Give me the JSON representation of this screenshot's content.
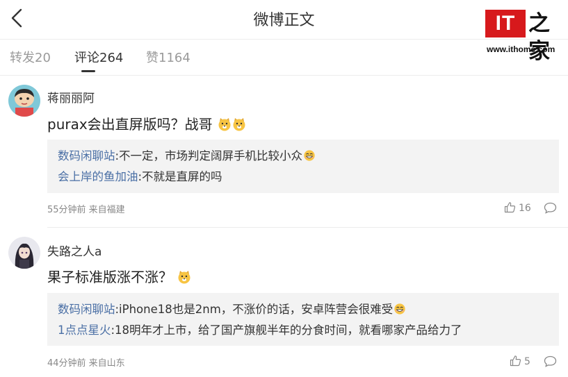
{
  "header": {
    "title": "微博正文"
  },
  "logo": {
    "brand": "IT之家",
    "it_text": "IT",
    "zh_text": "之家",
    "url": "www.ithome.com"
  },
  "tabs": [
    {
      "label": "转发20",
      "active": false
    },
    {
      "label": "评论264",
      "active": true
    },
    {
      "label": "赞1164",
      "active": false
    }
  ],
  "comments": [
    {
      "user": "蒋丽丽阿",
      "text": "purax会出直屏版吗？战哥",
      "emojis": [
        "doge-emoji",
        "doge-emoji"
      ],
      "replies": [
        {
          "user": "数码闲聊站",
          "text": ":不一定，市场判定阔屏手机比较小众",
          "emoji": "laugh-emoji"
        },
        {
          "user": "会上岸的鱼加油",
          "text": ":不就是直屏的吗",
          "emoji": null
        }
      ],
      "meta": "55分钟前 来自福建",
      "likes": "16"
    },
    {
      "user": "失路之人a",
      "text": "果子标准版涨不涨？",
      "emojis": [
        "doge-emoji"
      ],
      "replies": [
        {
          "user": "数码闲聊站",
          "text": ":iPhone18也是2nm，不涨价的话，安卓阵营会很难受",
          "emoji": "laugh-emoji"
        },
        {
          "user": "1点点星火",
          "text": ":18明年才上市，给了国产旗舰半年的分食时间，就看哪家产品给力了",
          "emoji": null
        }
      ],
      "meta": "44分钟前 来自山东",
      "likes": "5"
    }
  ],
  "colors": {
    "accent_link": "#4a6fa5",
    "logo_red": "#d7191c",
    "emoji_yellow": "#f7c443"
  }
}
